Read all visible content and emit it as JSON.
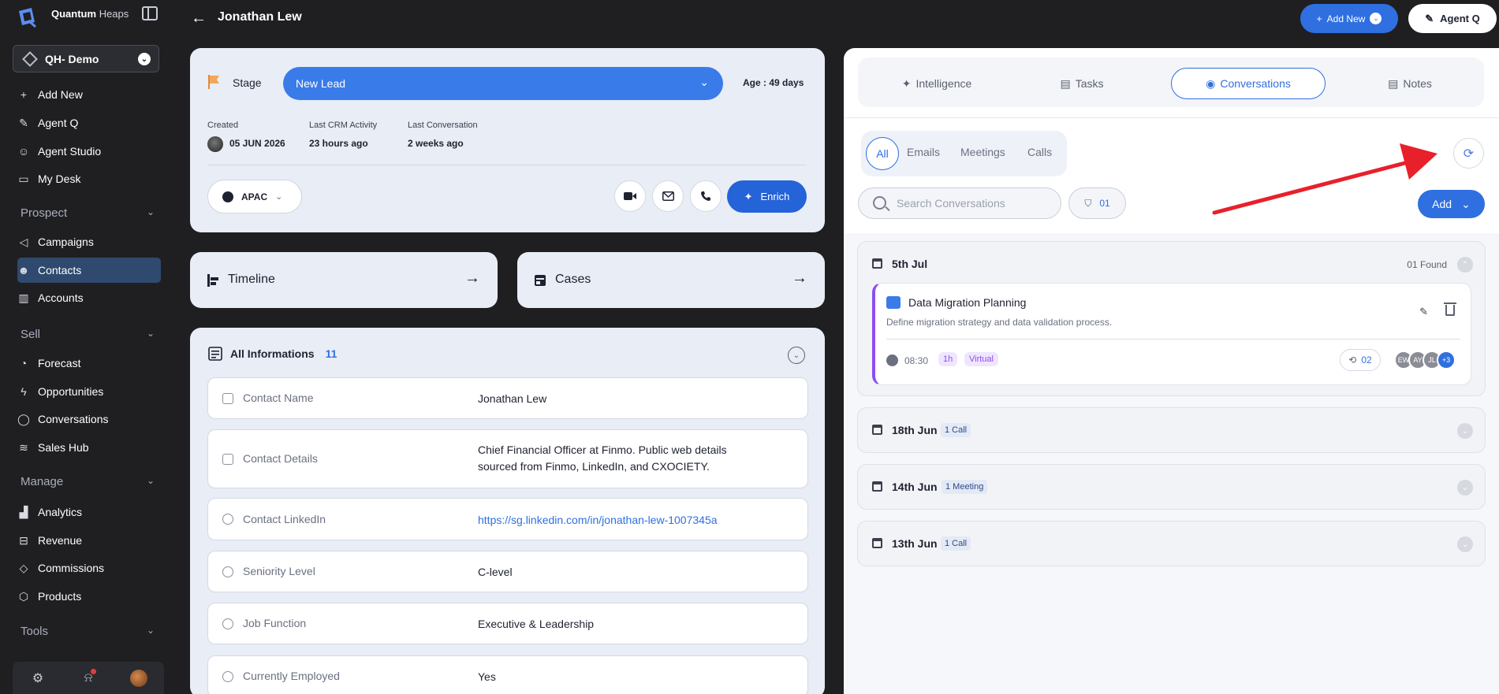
{
  "sidebar": {
    "brand_a": "Quantum",
    "brand_b": "Heaps",
    "workspace": "QH- Demo",
    "items": [
      {
        "label": "Add New"
      },
      {
        "label": "Agent Q"
      },
      {
        "label": "Agent Studio"
      },
      {
        "label": "My Desk"
      }
    ],
    "prospect_section": "Prospect",
    "prospect_items": [
      {
        "label": "Campaigns"
      },
      {
        "label": "Contacts"
      },
      {
        "label": "Accounts"
      }
    ],
    "sell_section": "Sell",
    "sell_items": [
      {
        "label": "Forecast"
      },
      {
        "label": "Opportunities"
      },
      {
        "label": "Conversations"
      },
      {
        "label": "Sales Hub"
      }
    ],
    "manage_section": "Manage",
    "manage_items": [
      {
        "label": "Analytics"
      },
      {
        "label": "Revenue"
      },
      {
        "label": "Commissions"
      },
      {
        "label": "Products"
      }
    ],
    "tools_section": "Tools",
    "active": "Contacts"
  },
  "header": {
    "title": "Jonathan Lew",
    "add_new": "Add New",
    "agent_q": "Agent Q"
  },
  "stage": {
    "label": "Stage",
    "value": "New Lead",
    "age": "Age : 49 days",
    "created_label": "Created",
    "created_value": "05 JUN 2026",
    "last_crm_label": "Last CRM Activity",
    "last_crm_value": "23 hours ago",
    "last_conv_label": "Last Conversation",
    "last_conv_value": "2 weeks ago",
    "region": "APAC",
    "enrich": "Enrich"
  },
  "links": {
    "timeline": "Timeline",
    "cases": "Cases"
  },
  "info": {
    "title": "All Informations",
    "count": "11",
    "rows": [
      {
        "label": "Contact Name",
        "value": "Jonathan Lew"
      },
      {
        "label": "Contact Details",
        "value": "Chief Financial Officer at Finmo. Public web details sourced from Finmo, LinkedIn, and CXOCIETY."
      },
      {
        "label": "Contact LinkedIn",
        "value": "https://sg.linkedin.com/in/jonathan-lew-1007345a"
      },
      {
        "label": "Seniority Level",
        "value": "C-level"
      },
      {
        "label": "Job Function",
        "value": "Executive & Leadership"
      },
      {
        "label": "Currently Employed",
        "value": "Yes"
      }
    ]
  },
  "right": {
    "tabs": [
      "Intelligence",
      "Tasks",
      "Conversations",
      "Notes"
    ],
    "selected_tab": "Conversations",
    "filters": [
      "All",
      "Emails",
      "Meetings",
      "Calls"
    ],
    "search_placeholder": "Search Conversations",
    "filter_count": "01",
    "add": "Add",
    "groups": [
      {
        "date": "5th Jul",
        "found": "01 Found"
      },
      {
        "date": "18th Jun",
        "badge": "1 Call"
      },
      {
        "date": "14th Jun",
        "badge": "1 Meeting"
      },
      {
        "date": "13th Jun",
        "badge": "1 Call"
      }
    ],
    "meeting": {
      "title": "Data Migration Planning",
      "desc": "Define migration strategy and data validation process.",
      "time": "08:30",
      "duration": "1h",
      "type": "Virtual",
      "recordings": "02",
      "attendees": [
        "EW",
        "AY",
        "JL"
      ],
      "more": "+3"
    }
  },
  "colors": {
    "accent": "#2f6fe0",
    "sidebar": "#1f1f22",
    "annotation_arrow": "#e8202a"
  }
}
